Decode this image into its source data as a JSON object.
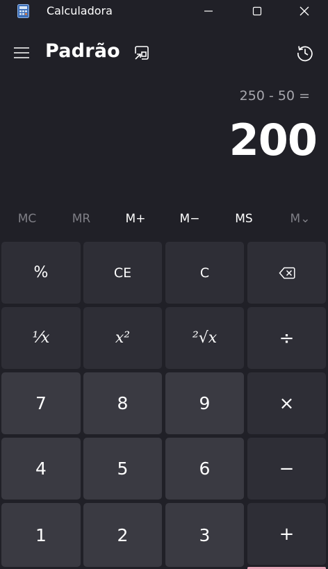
{
  "window": {
    "title": "Calculadora",
    "icon": "calculator-icon",
    "controls": [
      "minimize-icon",
      "maximize-icon",
      "close-icon"
    ]
  },
  "header": {
    "mode": "Padrão",
    "menu_icon": "hamburger-icon",
    "keep_on_top_icon": "keep-on-top-icon",
    "history_icon": "history-icon"
  },
  "display": {
    "expression": "250 - 50 =",
    "result": "200"
  },
  "memory": {
    "buttons": [
      {
        "label": "MC",
        "enabled": false
      },
      {
        "label": "MR",
        "enabled": false
      },
      {
        "label": "M+",
        "enabled": true
      },
      {
        "label": "M−",
        "enabled": true
      },
      {
        "label": "MS",
        "enabled": true
      },
      {
        "label": "M⌄",
        "enabled": false
      }
    ]
  },
  "keypad": {
    "percent": "%",
    "clear_entry": "CE",
    "clear": "C",
    "backspace_icon": "backspace-icon",
    "reciprocal": "¹⁄x",
    "square": "x²",
    "square_root": "²√x",
    "divide": "÷",
    "seven": "7",
    "eight": "8",
    "nine": "9",
    "multiply": "×",
    "four": "4",
    "five": "5",
    "six": "6",
    "minus": "−",
    "one": "1",
    "two": "2",
    "three": "3",
    "plus": "+"
  },
  "colors": {
    "background": "#202027",
    "function_key": "#2e2e36",
    "number_key": "#3a3a42",
    "accent": "#e8a5b8",
    "dim_text": "#7f7f86"
  }
}
